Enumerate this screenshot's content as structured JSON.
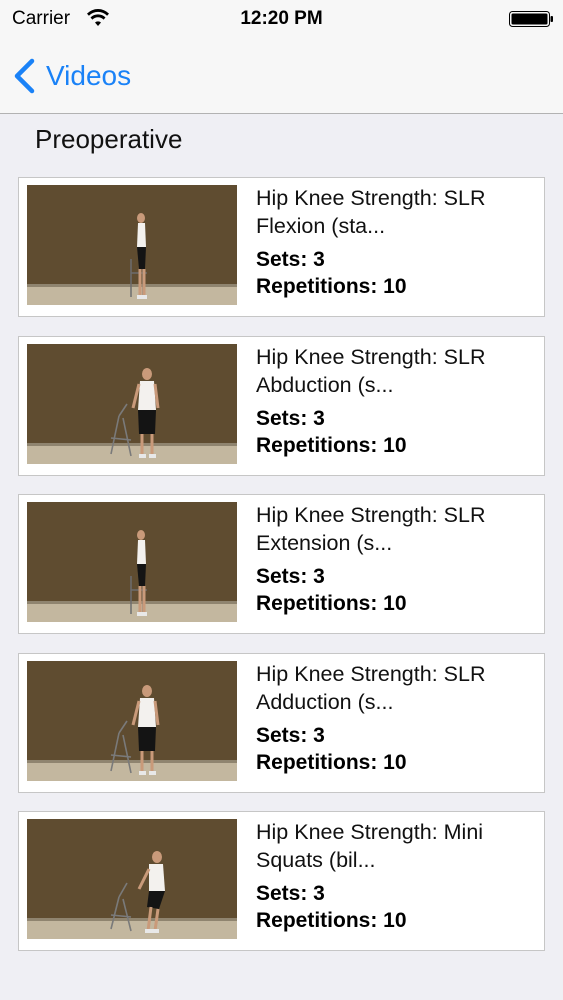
{
  "status_bar": {
    "carrier": "Carrier",
    "time": "12:20 PM",
    "wifi_icon": "wifi-icon",
    "battery_icon": "battery-full-icon"
  },
  "nav": {
    "back_label": "Videos",
    "back_icon": "chevron-left-icon",
    "accent_color": "#1a82f7"
  },
  "section": {
    "title": "Preoperative"
  },
  "videos": [
    {
      "title_line1": "Hip Knee Strength: SLR",
      "title_line2": "Flexion (sta...",
      "sets": "Sets: 3",
      "reps": "Repetitions: 10"
    },
    {
      "title_line1": "Hip Knee Strength: SLR",
      "title_line2": "Abduction (s...",
      "sets": "Sets: 3",
      "reps": "Repetitions: 10"
    },
    {
      "title_line1": "Hip Knee Strength: SLR",
      "title_line2": "Extension (s...",
      "sets": "Sets: 3",
      "reps": "Repetitions: 10"
    },
    {
      "title_line1": "Hip Knee Strength: SLR",
      "title_line2": "Adduction (s...",
      "sets": "Sets: 3",
      "reps": "Repetitions: 10"
    },
    {
      "title_line1": "Hip Knee Strength: Mini",
      "title_line2": "Squats (bil...",
      "sets": "Sets: 3",
      "reps": "Repetitions: 10"
    }
  ]
}
